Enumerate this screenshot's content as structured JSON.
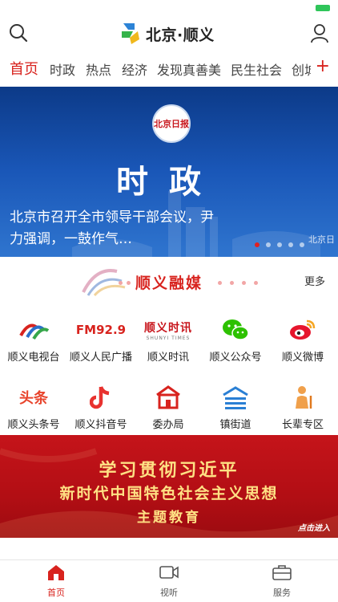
{
  "header": {
    "logo_text": "北京·顺义"
  },
  "tabs": [
    "首页",
    "时政",
    "热点",
    "经济",
    "发现真善美",
    "民生社会",
    "创城"
  ],
  "tabs_plus": "+",
  "banner": {
    "badge": "北京日报",
    "watermark": "北京日",
    "heading": "时政",
    "title": "北京市召开全市领导干部会议，尹力强调，一鼓作气…"
  },
  "section": {
    "title": "顺义融媒",
    "more": "更多"
  },
  "grid_row1": [
    {
      "label": "顺义电视台"
    },
    {
      "label": "顺义人民广播",
      "icon_text": "FM92.9"
    },
    {
      "label": "顺义时讯",
      "icon_text": "顺义时讯",
      "icon_sub": "SHUNYI TIMES"
    },
    {
      "label": "顺义公众号"
    },
    {
      "label": "顺义微博"
    }
  ],
  "grid_row2": [
    {
      "label": "顺义头条号",
      "icon_text": "头条"
    },
    {
      "label": "顺义抖音号"
    },
    {
      "label": "委办局"
    },
    {
      "label": "镇街道"
    },
    {
      "label": "长辈专区"
    }
  ],
  "promo": {
    "line1": "学习贯彻习近平",
    "line2": "新时代中国特色社会主义思想",
    "line3": "主题教育",
    "enter": "点击进入"
  },
  "tabbar": [
    {
      "label": "首页"
    },
    {
      "label": "视听"
    },
    {
      "label": "服务"
    }
  ],
  "colors": {
    "accent": "#d8231e",
    "promo_text": "#ffe184"
  }
}
